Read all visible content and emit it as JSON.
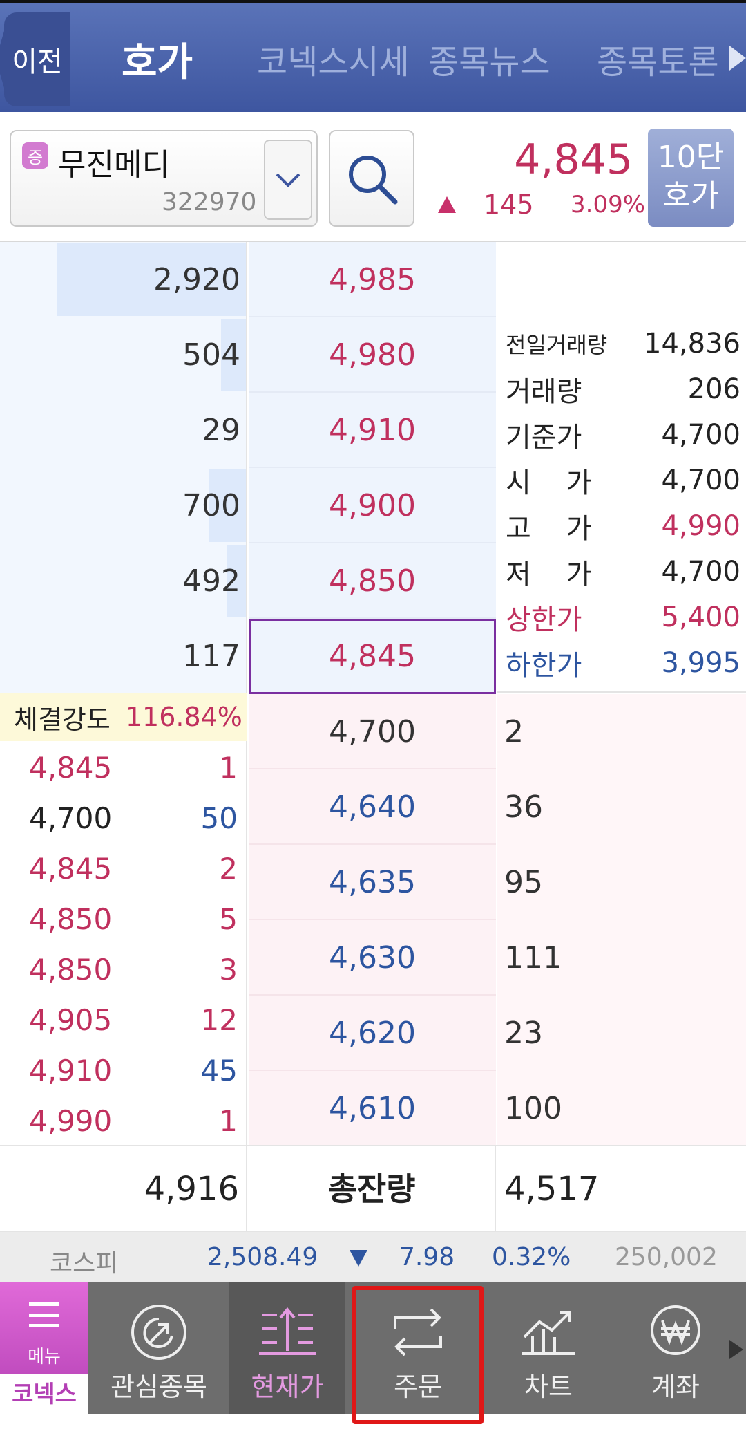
{
  "header": {
    "back_label": "이전",
    "tabs": [
      {
        "label": "호가",
        "active": true
      },
      {
        "label": "코넥스시세",
        "active": false
      },
      {
        "label": "종목뉴스",
        "active": false
      },
      {
        "label": "종목토론",
        "active": false
      }
    ]
  },
  "stock": {
    "badge": "증",
    "name": "무진메디",
    "code": "322970",
    "price": "4,845",
    "change": "145",
    "change_pct": "3.09%",
    "tenstep_label_1": "10단",
    "tenstep_label_2": "호가"
  },
  "asks": [
    {
      "qty": "2,920",
      "price": "4,985",
      "bar": 0.77
    },
    {
      "qty": "504",
      "price": "4,980",
      "bar": 0.1
    },
    {
      "qty": "29",
      "price": "4,910",
      "bar": 0.0
    },
    {
      "qty": "700",
      "price": "4,900",
      "bar": 0.15
    },
    {
      "qty": "492",
      "price": "4,850",
      "bar": 0.08
    },
    {
      "qty": "117",
      "price": "4,845",
      "bar": 0.0
    }
  ],
  "bids": [
    {
      "price": "4,700",
      "qty": "2"
    },
    {
      "price": "4,640",
      "qty": "36"
    },
    {
      "price": "4,635",
      "qty": "95"
    },
    {
      "price": "4,630",
      "qty": "111"
    },
    {
      "price": "4,620",
      "qty": "23"
    },
    {
      "price": "4,610",
      "qty": "100"
    }
  ],
  "info": [
    {
      "label": "전일거래량",
      "value": "14,836",
      "color": "#222"
    },
    {
      "label": "거래량",
      "value": "206",
      "color": "#222"
    },
    {
      "label": "기준가",
      "value": "4,700",
      "color": "#222"
    },
    {
      "label": "시    가",
      "value": "4,700",
      "color": "#222"
    },
    {
      "label": "고    가",
      "value": "4,990",
      "color": "#c0305e"
    },
    {
      "label": "저    가",
      "value": "4,700",
      "color": "#222"
    },
    {
      "label": "상한가",
      "value": "5,400",
      "color": "#c0305e"
    },
    {
      "label": "하한가",
      "value": "3,995",
      "color": "#2d55a0"
    }
  ],
  "strength": {
    "label": "체결강도",
    "value": "116.84%"
  },
  "trades": [
    {
      "price": "4,845",
      "qty": "1",
      "pcolor": "#c0305e",
      "qcolor": "#c0305e"
    },
    {
      "price": "4,700",
      "qty": "50",
      "pcolor": "#222",
      "qcolor": "#2d55a0"
    },
    {
      "price": "4,845",
      "qty": "2",
      "pcolor": "#c0305e",
      "qcolor": "#c0305e"
    },
    {
      "price": "4,850",
      "qty": "5",
      "pcolor": "#c0305e",
      "qcolor": "#c0305e"
    },
    {
      "price": "4,850",
      "qty": "3",
      "pcolor": "#c0305e",
      "qcolor": "#c0305e"
    },
    {
      "price": "4,905",
      "qty": "12",
      "pcolor": "#c0305e",
      "qcolor": "#c0305e"
    },
    {
      "price": "4,910",
      "qty": "45",
      "pcolor": "#c0305e",
      "qcolor": "#2d55a0"
    },
    {
      "price": "4,990",
      "qty": "1",
      "pcolor": "#c0305e",
      "qcolor": "#c0305e"
    }
  ],
  "totals": {
    "ask_total": "4,916",
    "label": "총잔량",
    "bid_total": "4,517"
  },
  "index_bar": {
    "name": "코스피",
    "value": "2,508.49",
    "change": "7.98",
    "pct": "0.32%",
    "volume": "250,002"
  },
  "nav": {
    "menu_label": "메뉴",
    "brand": "코넥스",
    "items": [
      {
        "label": "관심종목",
        "icon": "target-icon"
      },
      {
        "label": "현재가",
        "icon": "current-price-icon"
      },
      {
        "label": "주문",
        "icon": "swap-arrows-icon"
      },
      {
        "label": "차트",
        "icon": "chart-icon"
      },
      {
        "label": "계좌",
        "icon": "won-icon"
      }
    ]
  }
}
